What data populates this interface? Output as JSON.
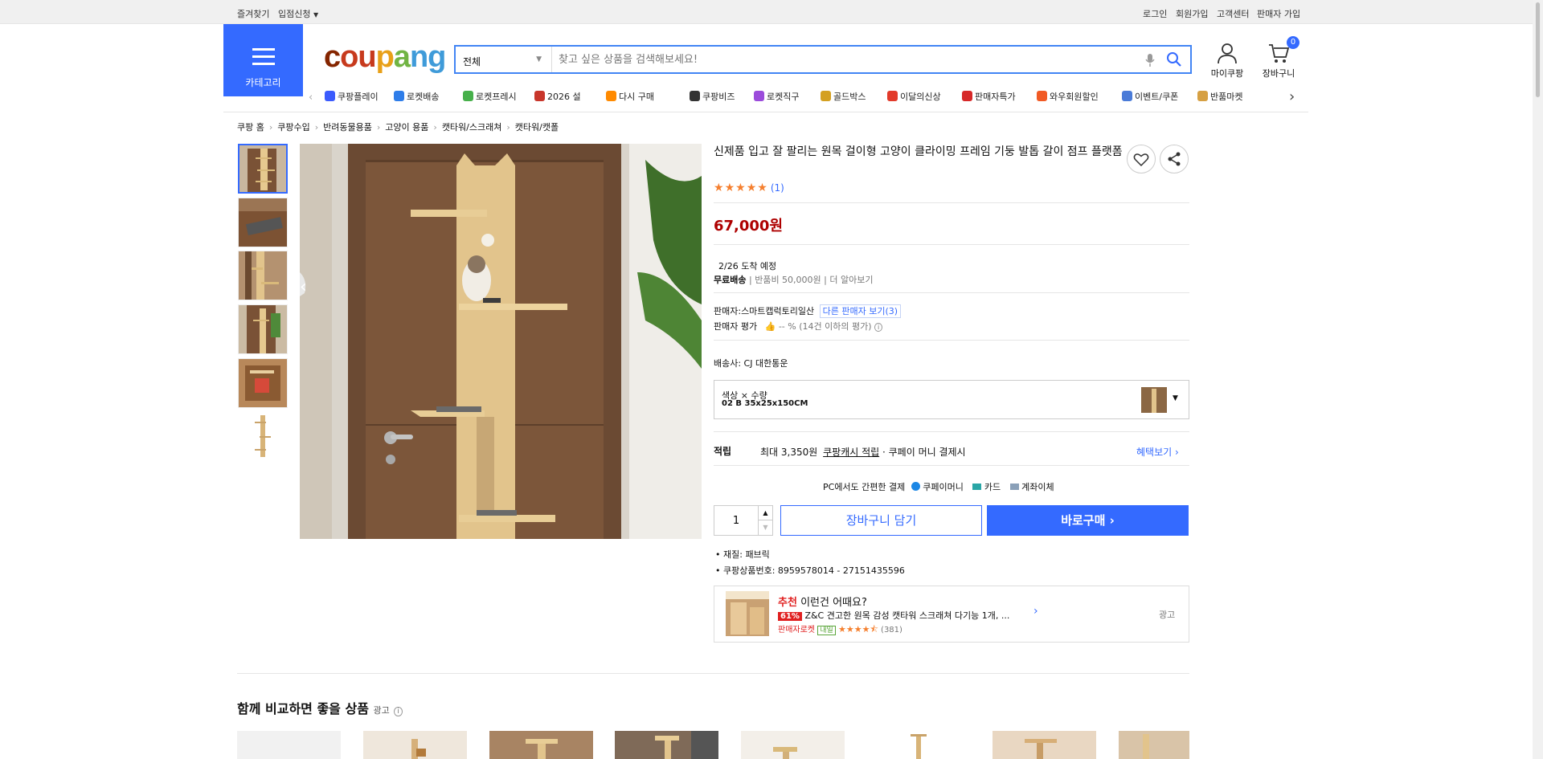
{
  "topbar": {
    "left": [
      "즐겨찾기",
      "입점신청"
    ],
    "right": [
      "로그인",
      "회원가입",
      "고객센터",
      "판매자 가입"
    ]
  },
  "header": {
    "category_label": "카테고리",
    "logo": "coupang",
    "search_select": "전체",
    "search_placeholder": "찾고 싶은 상품을 검색해보세요!",
    "mycoupang": "마이쿠팡",
    "cart": "장바구니",
    "cart_count": "0"
  },
  "catnav": [
    {
      "label": "쿠팡플레이",
      "color": "#3b5bfd"
    },
    {
      "label": "로켓배송",
      "color": "#2e7de9"
    },
    {
      "label": "로켓프레시",
      "color": "#47b04b"
    },
    {
      "label": "2026 설",
      "color": "#c8362b"
    },
    {
      "label": "다시 구매",
      "color": "#ff8a00"
    },
    {
      "label": "쿠팡비즈",
      "color": "#333333"
    },
    {
      "label": "로켓직구",
      "color": "#9b4bdb"
    },
    {
      "label": "골드박스",
      "color": "#d4a020"
    },
    {
      "label": "이달의신상",
      "color": "#e23a2a"
    },
    {
      "label": "판매자특가",
      "color": "#d62828"
    },
    {
      "label": "와우회원할인",
      "color": "#f15a24"
    },
    {
      "label": "이벤트/쿠폰",
      "color": "#4a7bd8"
    },
    {
      "label": "반품마켓",
      "color": "#d6a043"
    }
  ],
  "breadcrumb": [
    "쿠팡 홈",
    "쿠팡수입",
    "반려동물용품",
    "고양이 용품",
    "캣타워/스크래쳐",
    "캣타워/캣폴"
  ],
  "product": {
    "title": "신제품 입고 잘 팔리는 원목 걸이형 고양이 클라이밍 프레임 기둥 발톱 갈이 점프 플랫폼",
    "rating": 5,
    "review_count": "(1)",
    "price": "67,000원",
    "arrival": "2/26 도착 예정",
    "shipping_free": "무료배송",
    "return_fee": "반품비 50,000원",
    "learn_more": "더 알아보기",
    "seller": "판매자:스마트캡럭토리일산",
    "other_sellers": "다른 판매자 보기(3)",
    "seller_rating_label": "판매자 평가",
    "seller_rating_value": "-- %",
    "seller_rating_note": "(14건 이하의 평가)",
    "carrier": "배송사:  CJ 대한통운",
    "option_label": "색상 × 수량",
    "option_value": "02 B 35x25x150CM",
    "points_label": "적립",
    "points_max": "최대 3,350원",
    "points_cash": "쿠팡캐시 적립",
    "points_cond": "· 쿠페이 머니 결제시",
    "benefit_link": "혜택보기",
    "pay_title": "PC에서도 간편한 결제",
    "pay_methods": [
      "쿠페이머니",
      "카드",
      "계좌이체"
    ],
    "quantity": "1",
    "add_cart": "장바구니 담기",
    "buy_now": "바로구매",
    "specs": [
      "재질: 패브릭",
      "쿠팡상품번호: 8959578014 - 27151435596"
    ]
  },
  "recommend": {
    "tag": "추천",
    "title": "이런건 어때요?",
    "discount": "61%",
    "name": "Z&C 견고한 원목 감성 캣타워 스크래쳐 다기능 1개, ...",
    "seller_badge": "판매자로켓",
    "tomorrow": "내일",
    "rating": 4.5,
    "reviews": "(381)",
    "ad": "광고"
  },
  "compare": {
    "title": "함께 비교하면 좋을 상품",
    "ad": "광고"
  }
}
